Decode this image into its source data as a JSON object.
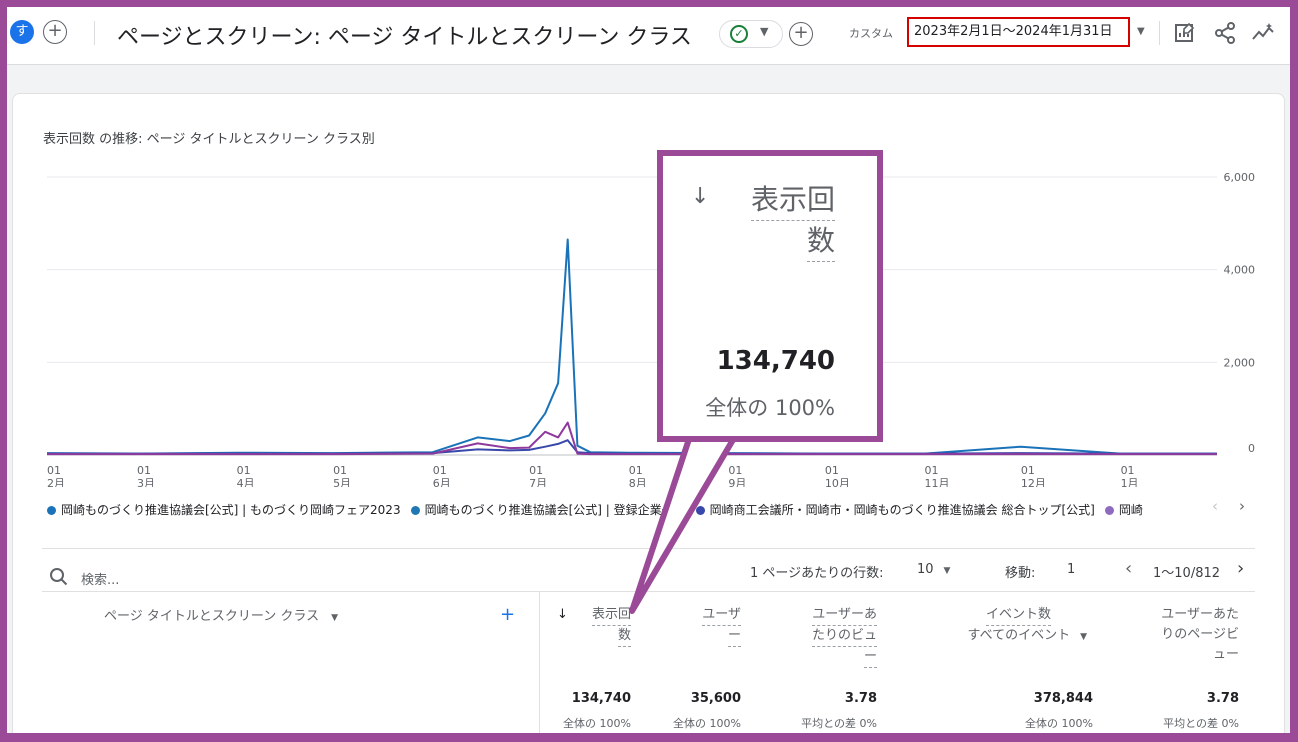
{
  "header": {
    "avatar": "す",
    "add_glyph": "+",
    "title": "ページとスクリーン: ページ タイトルとスクリーン クラス",
    "status_check": "✓",
    "custom_label": "カスタム",
    "date_range": "2023年2月1日～2024年1月31日",
    "icons": [
      "add-icon",
      "check-icon",
      "edit-report-icon",
      "share-icon",
      "insights-icon"
    ]
  },
  "chart": {
    "title": "表示回数 の推移: ページ タイトルとスクリーン クラス別",
    "y_ticks": [
      "6,000",
      "4,000",
      "2,000",
      "0"
    ],
    "x_ticks": [
      {
        "day": "01",
        "month": "2月"
      },
      {
        "day": "01",
        "month": "3月"
      },
      {
        "day": "01",
        "month": "4月"
      },
      {
        "day": "01",
        "month": "5月"
      },
      {
        "day": "01",
        "month": "6月"
      },
      {
        "day": "01",
        "month": "7月"
      },
      {
        "day": "01",
        "month": "8月"
      },
      {
        "day": "01",
        "month": "9月"
      },
      {
        "day": "01",
        "month": "10月"
      },
      {
        "day": "01",
        "month": "11月"
      },
      {
        "day": "01",
        "month": "12月"
      },
      {
        "day": "01",
        "month": "1月"
      }
    ],
    "legend": [
      {
        "label": "岡崎ものづくり推進協議会[公式] | ものづくり岡崎フェア2023",
        "color": "#1a73b8"
      },
      {
        "label": "岡崎ものづくり推進協議会[公式] | 登録企業一覧",
        "color": "#1f78b4"
      },
      {
        "label": "岡崎商工会議所・岡崎市・岡崎ものづくり推進協議会 総合トップ[公式]",
        "color": "#3949ab"
      },
      {
        "label": "岡崎",
        "color": "#8e6bbf"
      }
    ],
    "legend_prev": "‹",
    "legend_next": "›"
  },
  "chart_data": {
    "type": "line",
    "title": "表示回数 の推移: ページ タイトルとスクリーン クラス別",
    "ylim": [
      0,
      6000
    ],
    "x": [
      "2023-02-01",
      "2023-03-01",
      "2023-04-01",
      "2023-05-01",
      "2023-06-01",
      "2023-06-15",
      "2023-06-25",
      "2023-07-01",
      "2023-07-06",
      "2023-07-10",
      "2023-07-13",
      "2023-07-16",
      "2023-07-20",
      "2023-08-01",
      "2023-09-01",
      "2023-10-01",
      "2023-11-01",
      "2023-12-01",
      "2024-01-01",
      "2024-01-31"
    ],
    "series": [
      {
        "name": "岡崎ものづくり推進協議会[公式] | ものづくり岡崎フェア2023",
        "values": [
          40,
          30,
          50,
          40,
          60,
          380,
          300,
          420,
          900,
          1550,
          4650,
          200,
          60,
          50,
          40,
          30,
          30,
          180,
          30,
          30
        ]
      },
      {
        "name": "岡崎商工会議所・岡崎市・岡崎ものづくり推進協議会 総合トップ[公式]",
        "values": [
          30,
          30,
          30,
          30,
          40,
          120,
          100,
          110,
          180,
          240,
          320,
          60,
          40,
          30,
          30,
          30,
          30,
          40,
          30,
          30
        ]
      },
      {
        "name": "岡崎",
        "values": [
          20,
          20,
          20,
          20,
          30,
          250,
          150,
          160,
          500,
          380,
          700,
          30,
          20,
          20,
          20,
          20,
          20,
          20,
          20,
          20
        ]
      }
    ]
  },
  "table": {
    "search_placeholder": "検索...",
    "rows_per_page_label": "1 ページあたりの行数:",
    "rows_per_page_value": "10",
    "goto_label": "移動:",
    "goto_value": "1",
    "pagination": "1〜10/812",
    "dimension_header": "ページ タイトルとスクリーン クラス",
    "add_column": "+",
    "sort_arrow": "↓",
    "columns": [
      {
        "line1": "表示回",
        "line2": "数",
        "line3": "",
        "total": "134,740",
        "sub": "全体の 100%"
      },
      {
        "line1": "ユーザ",
        "line2": "ー",
        "line3": "",
        "total": "35,600",
        "sub": "全体の 100%"
      },
      {
        "line1": "ユーザーあ",
        "line2": "たりのビュ",
        "line3": "ー",
        "total": "3.78",
        "sub": "平均との差 0%"
      },
      {
        "line1": "イベント数",
        "line2": "すべてのイベント",
        "line3": "",
        "total": "378,844",
        "sub": "全体の 100%"
      },
      {
        "line1": "ユーザーあた",
        "line2": "りのページビ",
        "line3": "ュー",
        "total": "3.78",
        "sub": "平均との差 0%"
      }
    ]
  },
  "callout": {
    "sort_arrow": "↓",
    "header_line1": "表示回",
    "header_line2": "数",
    "value": "134,740",
    "percent": "全体の 100%"
  },
  "colors": {
    "frame": "#9a4a96",
    "highlight": "#d50000",
    "primary_line": "#1a73b8",
    "secondary_line": "#3949ab",
    "tertiary_line": "#8e3a9d"
  }
}
